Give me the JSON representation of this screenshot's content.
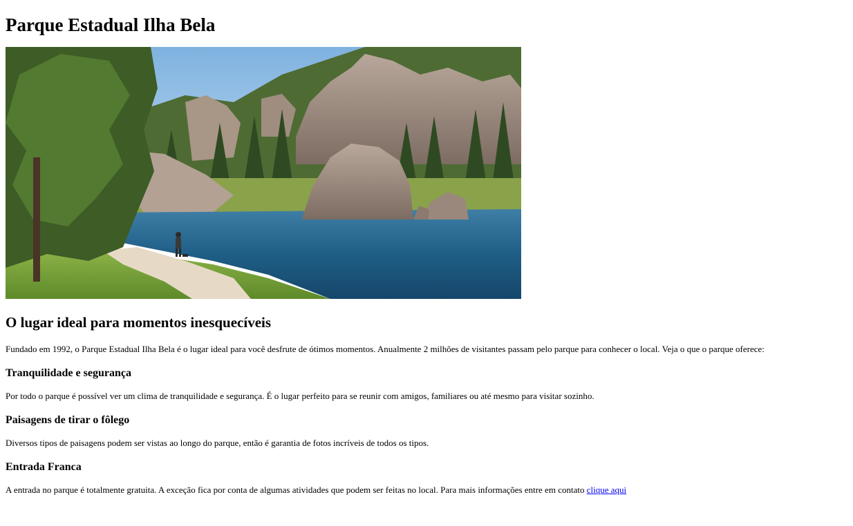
{
  "page": {
    "title": "Parque Estadual Ilha Bela",
    "hero_image": "lake-landscape-image"
  },
  "intro": {
    "heading": "O lugar ideal para momentos inesquecíveis",
    "text": "Fundado em 1992, o Parque Estadual Ilha Bela é o lugar ideal para você desfrute de ótimos momentos. Anualmente 2 milhões de visitantes passam pelo parque para conhecer o local. Veja o que o parque oferece:"
  },
  "sections": [
    {
      "heading": "Tranquilidade e segurança",
      "text": "Por todo o parque é possível ver um clima de tranquilidade e segurança. É o lugar perfeito para se reunir com amigos, familiares ou até mesmo para visitar sozinho."
    },
    {
      "heading": "Paisagens de tirar o fôlego",
      "text": "Diversos tipos de paisagens podem ser vistas ao longo do parque, então é garantia de fotos incríveis de todos os tipos."
    },
    {
      "heading": "Entrada Franca",
      "text": "A entrada no parque é totalmente gratuita. A exceção fica por conta de algumas atividades que podem ser feitas no local. Para mais informações entre em contato ",
      "link_text": "clique aqui"
    }
  ],
  "colors": {
    "link": "#0000ee",
    "text": "#000000",
    "background": "#ffffff"
  }
}
